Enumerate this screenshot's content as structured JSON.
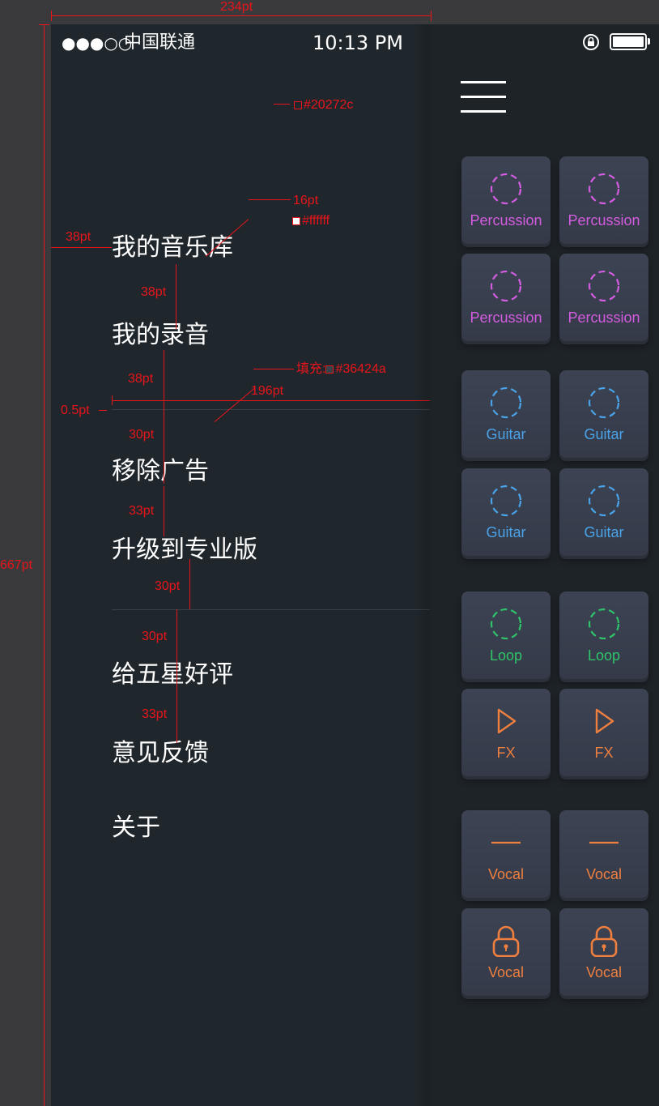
{
  "status_bar": {
    "signal": "●●●○○",
    "carrier": "中国联通",
    "time": "10:13 PM"
  },
  "drawer": {
    "menu_items": [
      "我的音乐库",
      "我的录音",
      "移除广告",
      "升级到专业版",
      "给五星好评",
      "意见反馈",
      "关于"
    ]
  },
  "pads": [
    {
      "label": "Percussion",
      "color": "#d45ce0",
      "icon": "dashed-circle-icon"
    },
    {
      "label": "Percussion",
      "color": "#d45ce0",
      "icon": "dashed-circle-icon"
    },
    {
      "label": "Percussion",
      "color": "#d45ce0",
      "icon": "dashed-circle-icon"
    },
    {
      "label": "Percussion",
      "color": "#d45ce0",
      "icon": "dashed-circle-icon"
    },
    {
      "label": "Guitar",
      "color": "#4aa3e8",
      "icon": "dashed-circle-icon"
    },
    {
      "label": "Guitar",
      "color": "#4aa3e8",
      "icon": "dashed-circle-icon"
    },
    {
      "label": "Guitar",
      "color": "#4aa3e8",
      "icon": "dashed-circle-icon"
    },
    {
      "label": "Guitar",
      "color": "#4aa3e8",
      "icon": "dashed-circle-icon"
    },
    {
      "label": "Loop",
      "color": "#2fc46a",
      "icon": "dashed-circle-icon"
    },
    {
      "label": "Loop",
      "color": "#2fc46a",
      "icon": "dashed-circle-icon"
    },
    {
      "label": "FX",
      "color": "#ef7f3f",
      "icon": "play-icon"
    },
    {
      "label": "FX",
      "color": "#ef7f3f",
      "icon": "play-icon"
    },
    {
      "label": "Vocal",
      "color": "#ef7f3f",
      "icon": "dash-icon"
    },
    {
      "label": "Vocal",
      "color": "#ef7f3f",
      "icon": "dash-icon"
    },
    {
      "label": "Vocal",
      "color": "#ef7f3f",
      "icon": "lock-icon"
    },
    {
      "label": "Vocal",
      "color": "#ef7f3f",
      "icon": "lock-icon"
    }
  ],
  "colors": {
    "drawer_bg": "#20272c",
    "divider": "#36424a",
    "text": "#ffffff",
    "annotation": "#e8141b"
  },
  "annotations": {
    "width_total": "234pt",
    "height_total": "667pt",
    "bg_color": "#20272c",
    "font_size": "16pt",
    "text_color": "#ffffff",
    "left_margin": "38pt",
    "gap_1": "38pt",
    "gap_2": "38pt",
    "fill_label": "填充:",
    "fill_color": "#36424a",
    "divider_width": "196pt",
    "divider_height": "0.5pt",
    "gap_3": "30pt",
    "gap_4": "33pt",
    "gap_5": "30pt",
    "gap_6": "30pt",
    "gap_7": "33pt"
  }
}
